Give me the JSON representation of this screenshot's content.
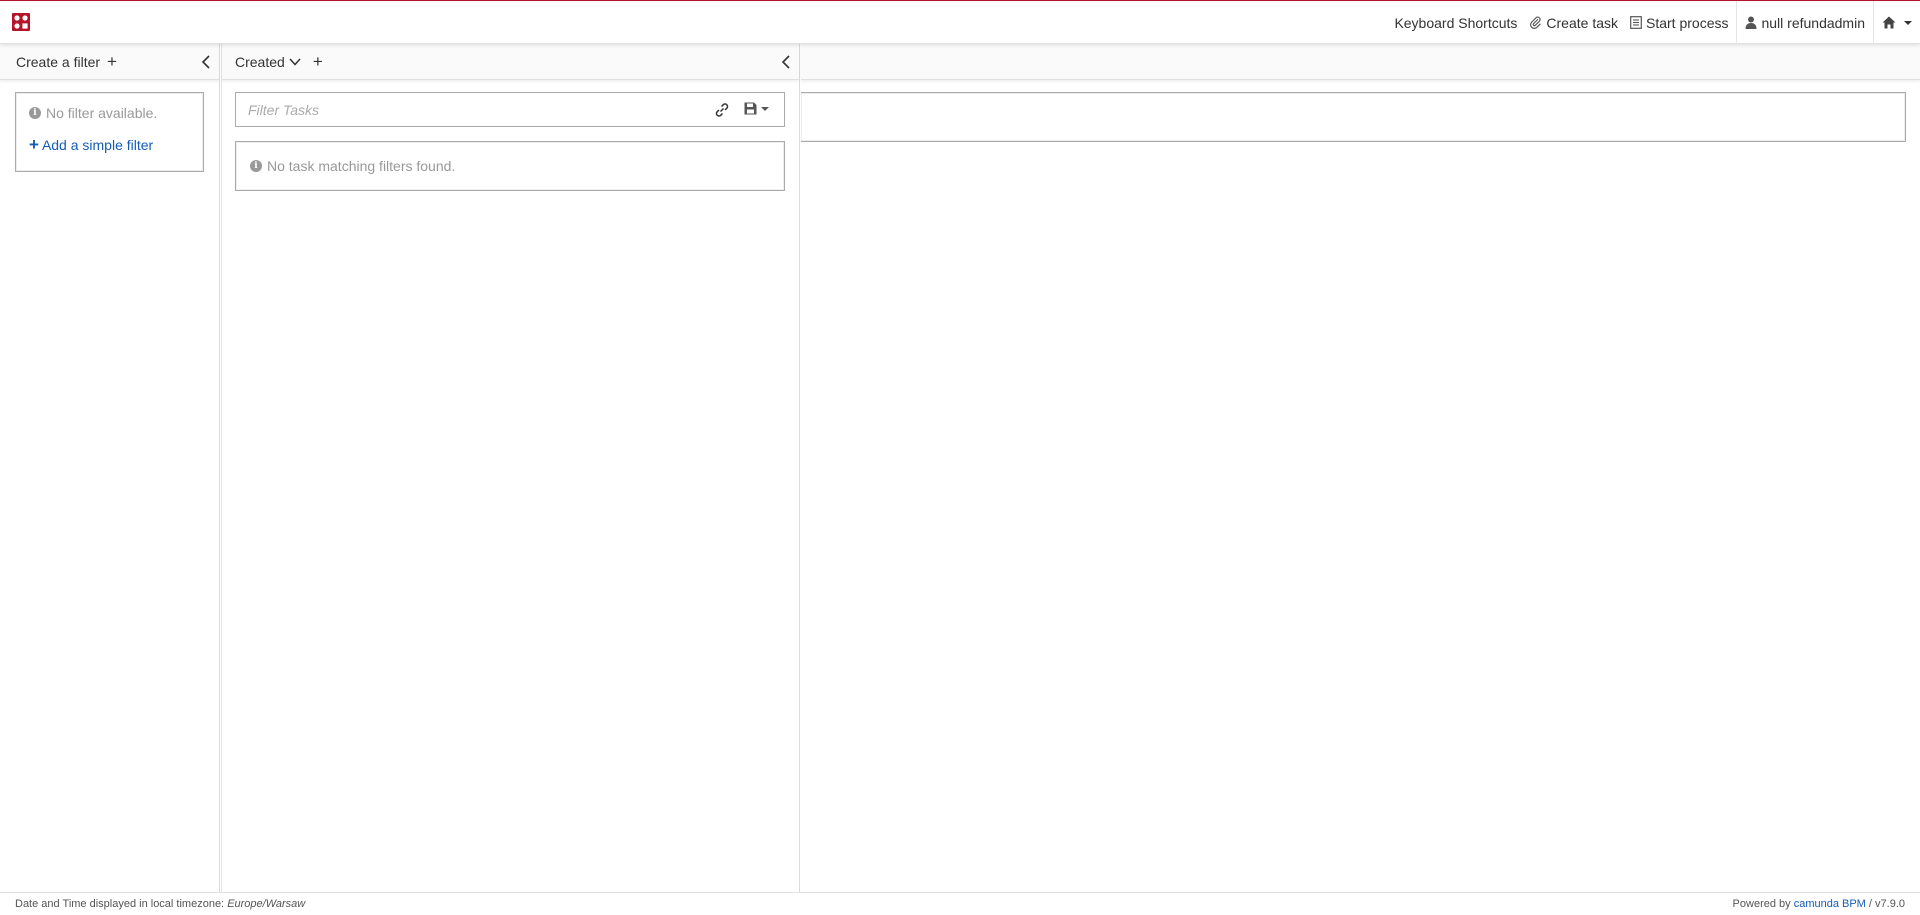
{
  "colors": {
    "brand": "#b5152b",
    "link": "#155cb5",
    "muted": "#999999",
    "border": "#aaaaaa"
  },
  "navbar": {
    "logo_icon": "camunda-logo-icon",
    "items": [
      {
        "label": "Keyboard Shortcuts",
        "icon": ""
      },
      {
        "label": "Create task",
        "icon": "paperclip-icon"
      },
      {
        "label": "Start process",
        "icon": "list-icon"
      },
      {
        "label": "null refundadmin",
        "icon": "user-icon"
      }
    ],
    "home_icon": "home-icon"
  },
  "filters": {
    "header_label": "Create a filter",
    "empty_message": "No filter available.",
    "add_link_label": "Add a simple filter"
  },
  "tasks": {
    "sort_label": "Created",
    "search_placeholder": "Filter Tasks",
    "empty_message": "No task matching filters found."
  },
  "footer": {
    "timezone_label": "Date and Time displayed in local timezone:",
    "timezone": "Europe/Warsaw",
    "powered_by": "Powered by",
    "product": "camunda BPM",
    "version": "/ v7.9.0"
  }
}
